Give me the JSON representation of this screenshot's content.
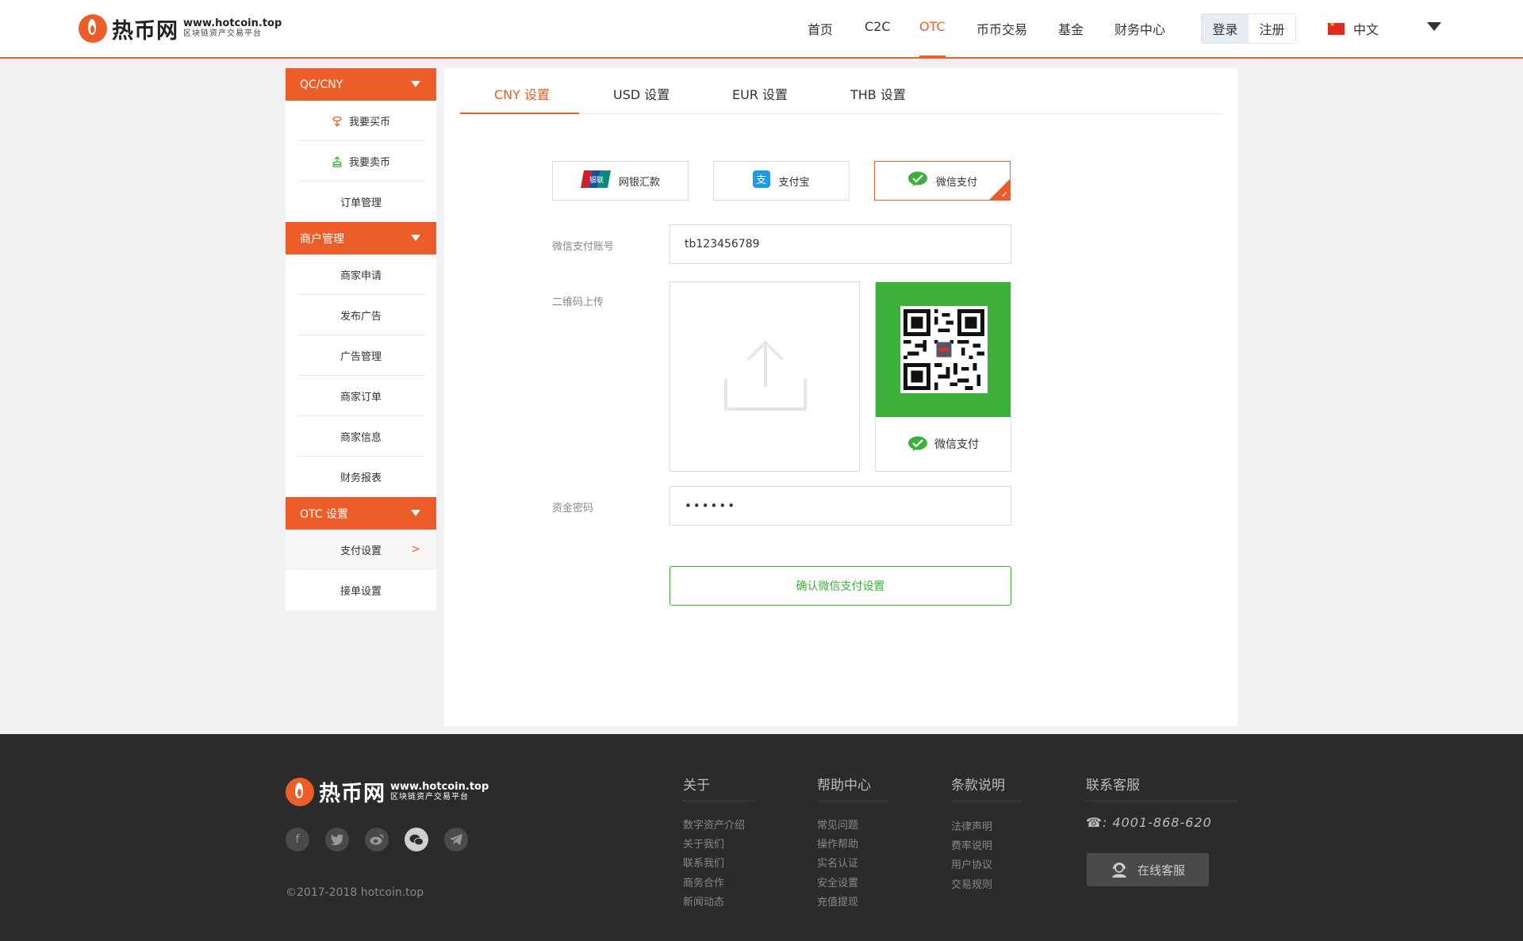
{
  "header": {
    "brand_name": "热币网",
    "brand_url": "www.hotcoin.top",
    "brand_tagline": "区块链资产交易平台",
    "nav": [
      "首页",
      "C2C",
      "OTC",
      "币币交易",
      "基金",
      "财务中心"
    ],
    "active_nav": "OTC",
    "login_label": "登录",
    "register_label": "注册",
    "language": "中文"
  },
  "sidebar": {
    "groups": [
      {
        "title": "QC/CNY",
        "items": [
          "我要买币",
          "我要卖币",
          "订单管理"
        ]
      },
      {
        "title": "商户管理",
        "items": [
          "商家申请",
          "发布广告",
          "广告管理",
          "商家订单",
          "商家信息",
          "财务报表"
        ]
      },
      {
        "title": "OTC 设置",
        "items": [
          "支付设置",
          "接单设置"
        ]
      }
    ],
    "active_item": "支付设置",
    "active_arrow": ">"
  },
  "main": {
    "tabs": [
      "CNY 设置",
      "USD 设置",
      "EUR 设置",
      "THB 设置"
    ],
    "active_tab": "CNY 设置",
    "payment_methods": [
      {
        "label": "网银汇款",
        "icon": "unionpay-icon"
      },
      {
        "label": "支付宝",
        "icon": "alipay-icon"
      },
      {
        "label": "微信支付",
        "icon": "wechat-pay-icon"
      }
    ],
    "selected_method": "微信支付",
    "form": {
      "account_label": "微信支付账号",
      "account_value": "tb123456789",
      "qr_label": "二维码上传",
      "qr_caption": "微信支付",
      "password_label": "资金密码",
      "password_value": "••••••",
      "confirm_label": "确认微信支付设置"
    }
  },
  "footer": {
    "brand_name": "热币网",
    "brand_url": "www.hotcoin.top",
    "brand_tagline": "区块链资产交易平台",
    "social": [
      "facebook-icon",
      "twitter-icon",
      "weibo-icon",
      "wechat-icon",
      "telegram-icon"
    ],
    "copyright": "©2017-2018 hotcoin.top",
    "columns": [
      {
        "title": "关于",
        "links": [
          "数字资产介绍",
          "关于我们",
          "联系我们",
          "商务合作",
          "新闻动态"
        ]
      },
      {
        "title": "帮助中心",
        "links": [
          "常见问题",
          "操作帮助",
          "实名认证",
          "安全设置",
          "充值提现"
        ]
      },
      {
        "title": "条款说明",
        "links": [
          "法律声明",
          "费率说明",
          "用户协议",
          "交易规则"
        ]
      }
    ],
    "contact_title": "联系客服",
    "phone": ": 4001-868-620",
    "service_label": "在线客服"
  },
  "colors": {
    "accent": "#ec5d2a",
    "wechat_green": "#3db03c",
    "footer_bg": "#2b2b2b"
  }
}
